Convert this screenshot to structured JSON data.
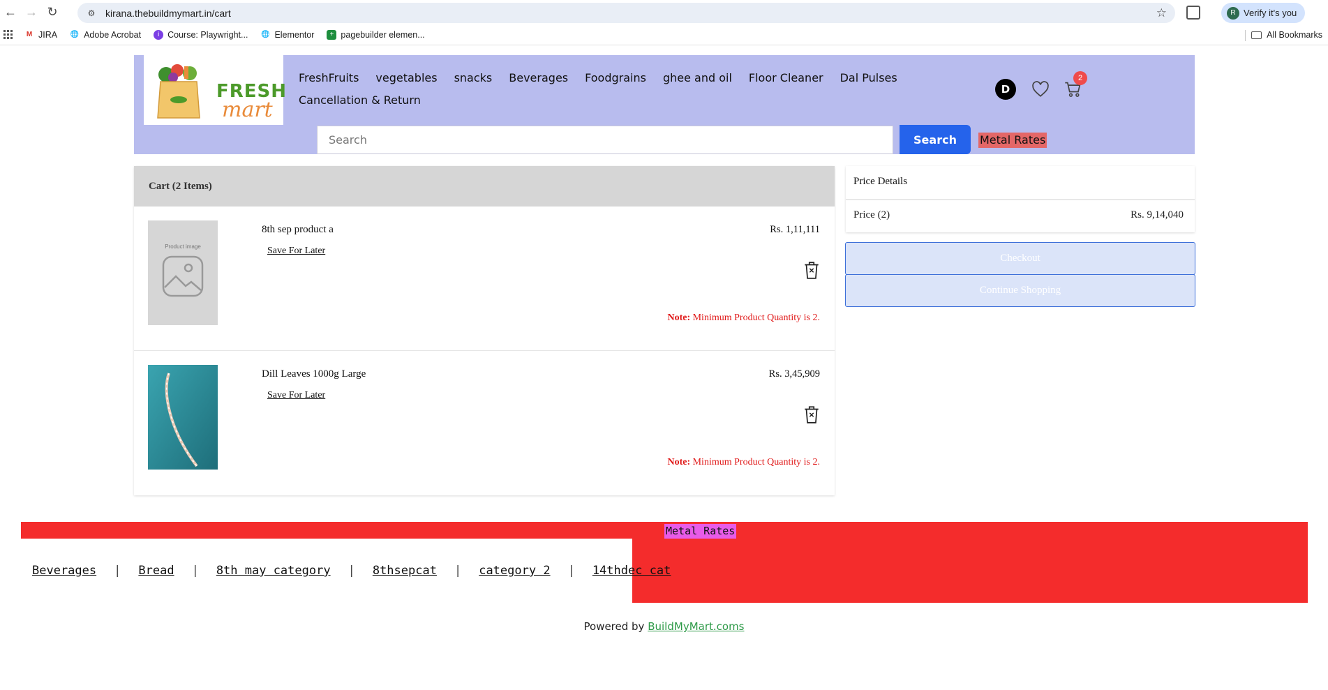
{
  "browser": {
    "url": "kirana.thebuildmymart.in/cart",
    "profile_label": "Verify it's you",
    "profile_initial": "R",
    "bookmarks": [
      "JIRA",
      "Adobe Acrobat",
      "Course: Playwright...",
      "Elementor",
      "pagebuilder elemen..."
    ],
    "all_bookmarks": "All Bookmarks"
  },
  "header": {
    "logo_word1": "FRESH",
    "logo_word2": "mart",
    "nav": [
      "FreshFruits",
      "vegetables",
      "snacks",
      "Beverages",
      "Foodgrains",
      "ghee and oil",
      "Floor Cleaner",
      "Dal Pulses",
      "Cancellation & Return"
    ],
    "user_initial": "D",
    "cart_count": "2",
    "search_placeholder": "Search",
    "search_button": "Search",
    "metal_rates": "Metal Rates"
  },
  "cart": {
    "title": "Cart (2 Items)",
    "items": [
      {
        "name": "8th sep product a",
        "save_for_later": "Save For Later",
        "price": "Rs. 1,11,111",
        "note_label": "Note:",
        "note_text": " Minimum Product Quantity is 2.",
        "image_label": "Product image"
      },
      {
        "name": "Dill Leaves 1000g Large",
        "save_for_later": "Save For Later",
        "price": "Rs. 3,45,909",
        "note_label": "Note:",
        "note_text": " Minimum Product Quantity is 2."
      }
    ]
  },
  "price_details": {
    "title": "Price Details",
    "price_label": "Price (2)",
    "price_value": "Rs. 9,14,040",
    "checkout": "Checkout",
    "continue_shopping": "Continue Shopping"
  },
  "footer": {
    "metal_rates": "Metal Rates",
    "categories": [
      "Beverages",
      "Bread",
      "8th may category",
      "8thsepcat",
      "category 2",
      "14thdec cat"
    ],
    "powered_prefix": "Powered by ",
    "powered_link": "BuildMyMart.coms"
  }
}
